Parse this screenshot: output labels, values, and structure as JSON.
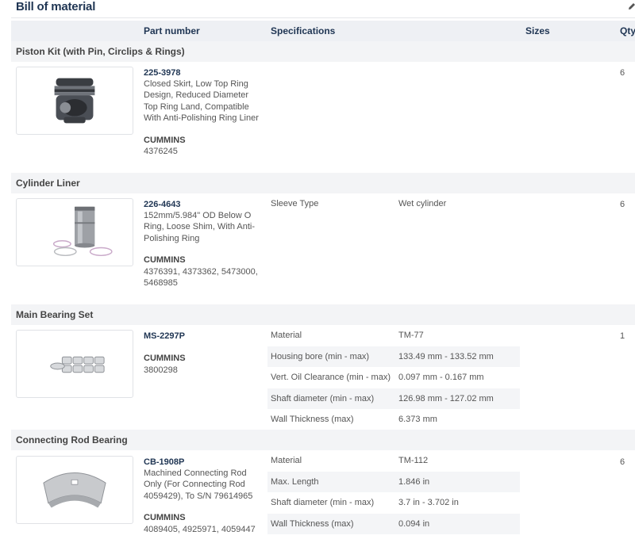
{
  "page": {
    "title": "Bill of material",
    "edit_icon": "pencil-icon"
  },
  "columns": {
    "part_number": "Part number",
    "specifications": "Specifications",
    "sizes": "Sizes",
    "qty": "Qty"
  },
  "sections": [
    {
      "name": "Piston Kit (with Pin, Circlips & Rings)",
      "part_number": "225-3978",
      "description": "Closed Skirt, Low Top Ring Design, Reduced Diameter Top Ring Land, Compatible With Anti-Polishing Ring Liner",
      "brand": "CUMMINS",
      "refs": "4376245",
      "qty": "6",
      "specs": []
    },
    {
      "name": "Cylinder Liner",
      "part_number": "226-4643",
      "description": "152mm/5.984\" OD Below O Ring, Loose Shim, With Anti-Polishing Ring",
      "brand": "CUMMINS",
      "refs": "4376391, 4373362, 5473000, 5468985",
      "qty": "6",
      "specs": [
        {
          "key": "Sleeve Type",
          "value": "Wet cylinder"
        }
      ]
    },
    {
      "name": "Main Bearing Set",
      "part_number": "MS-2297P",
      "description": "",
      "brand": "CUMMINS",
      "refs": "3800298",
      "qty": "1",
      "specs": [
        {
          "key": "Material",
          "value": "TM-77"
        },
        {
          "key": "Housing bore (min - max)",
          "value": "133.49 mm - 133.52 mm"
        },
        {
          "key": "Vert. Oil Clearance (min - max)",
          "value": "0.097 mm - 0.167 mm"
        },
        {
          "key": "Shaft diameter (min - max)",
          "value": "126.98 mm - 127.02 mm"
        },
        {
          "key": "Wall Thickness (max)",
          "value": "6.373 mm"
        }
      ]
    },
    {
      "name": "Connecting Rod Bearing",
      "part_number": "CB-1908P",
      "description": "Machined Connecting Rod Only (For Connecting Rod 4059429), To S/N 79614965",
      "brand": "CUMMINS",
      "refs": "4089405, 4925971, 4059447",
      "qty": "6",
      "specs": [
        {
          "key": "Material",
          "value": "TM-112"
        },
        {
          "key": "Max. Length",
          "value": "1.846 in"
        },
        {
          "key": "Shaft diameter (min - max)",
          "value": "3.7 in - 3.702 in"
        },
        {
          "key": "Wall Thickness (max)",
          "value": "0.094 in"
        }
      ]
    }
  ]
}
